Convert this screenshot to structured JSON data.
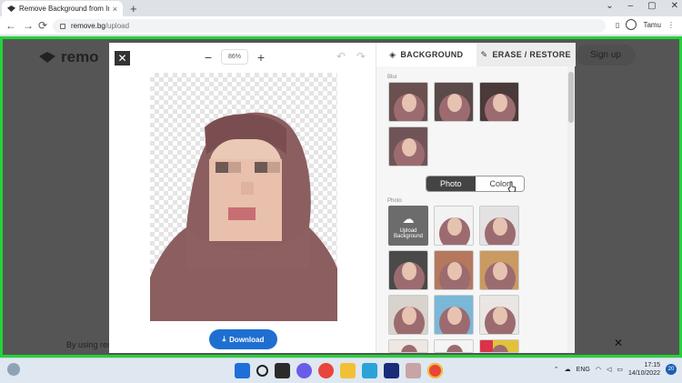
{
  "browser": {
    "tab_title": "Remove Background from Imag",
    "tab_close": "×",
    "new_tab": "+",
    "url_host": "remove.bg",
    "url_path": "/upload",
    "profile_name": "Tamu",
    "window_controls": [
      "⌄",
      "–",
      "▢",
      "✕"
    ]
  },
  "backdrop": {
    "logo": "remo",
    "signup": "Sign up",
    "cookie_text": "By using rem",
    "close": "✕"
  },
  "editor": {
    "close": "✕",
    "zoom_out": "−",
    "zoom_value": "86%",
    "zoom_in": "+",
    "undo": "↶",
    "redo": "↷",
    "download_label": "Download"
  },
  "panel": {
    "tabs": [
      {
        "label": "BACKGROUND",
        "icon": "layers-icon",
        "active": true
      },
      {
        "label": "ERASE / RESTORE",
        "icon": "brush-icon",
        "active": false
      }
    ],
    "blur_label": "Blur",
    "segment": {
      "photo": "Photo",
      "color": "Color",
      "selected": "photo"
    },
    "photo_label": "Photo",
    "upload_label": "Upload Background"
  },
  "taskbar": {
    "language": "ENG",
    "time": "17:15",
    "date": "14/10/2022",
    "notification_count": "20"
  }
}
